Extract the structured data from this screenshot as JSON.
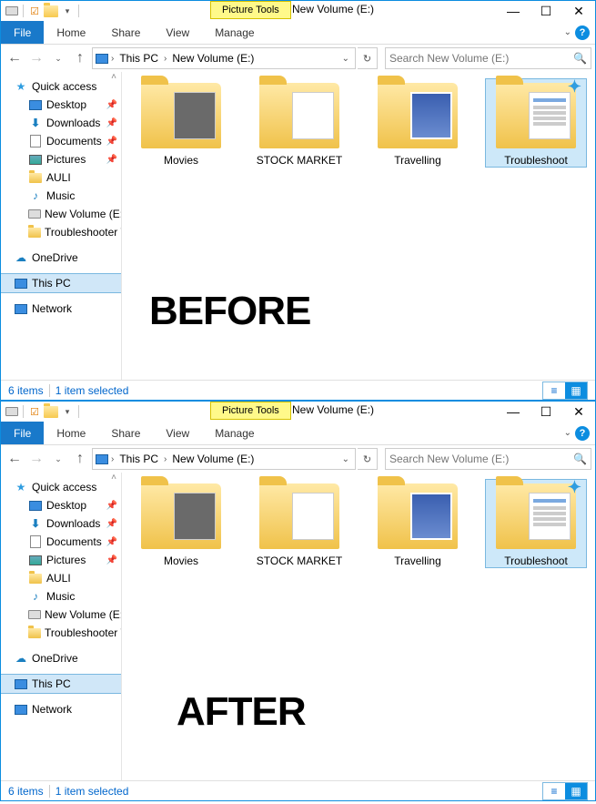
{
  "qat": {
    "context_tab": "Picture Tools"
  },
  "title": "New Volume (E:)",
  "tabs": {
    "file": "File",
    "home": "Home",
    "share": "Share",
    "view": "View",
    "manage": "Manage"
  },
  "breadcrumb": {
    "root": "This PC",
    "path": "New Volume (E:)"
  },
  "search": {
    "placeholder": "Search New Volume (E:)"
  },
  "sidebar": {
    "quick": "Quick access",
    "items": [
      {
        "label": "Desktop",
        "pin": true,
        "icon": "desktop"
      },
      {
        "label": "Downloads",
        "pin": true,
        "icon": "download"
      },
      {
        "label": "Documents",
        "pin": true,
        "icon": "document"
      },
      {
        "label": "Pictures",
        "pin": true,
        "icon": "picture"
      },
      {
        "label": "AULI",
        "pin": false,
        "icon": "folder"
      },
      {
        "label": "Music",
        "pin": false,
        "icon": "music"
      },
      {
        "label": "New Volume (E:)",
        "pin": false,
        "icon": "drive"
      },
      {
        "label": "Troubleshooter W",
        "pin": false,
        "icon": "folder"
      }
    ],
    "onedrive": "OneDrive",
    "thispc": "This PC",
    "network": "Network"
  },
  "folders": [
    {
      "label": "Movies",
      "thumb": "movie"
    },
    {
      "label": "STOCK MARKET",
      "thumb": "blank"
    },
    {
      "label": "Travelling",
      "thumb": "image"
    },
    {
      "label": "Troubleshoot",
      "thumb": "doc",
      "selected": true
    }
  ],
  "status": {
    "count": "6 items",
    "selected": "1 item selected"
  },
  "overlay": {
    "before": "BEFORE",
    "after": "AFTER"
  }
}
